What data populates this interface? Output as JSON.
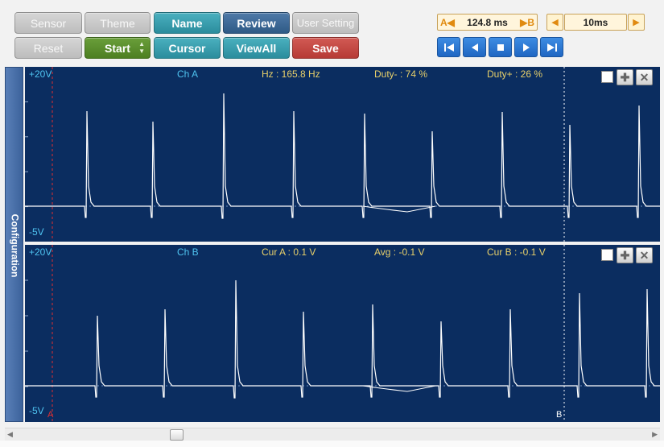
{
  "toolbar": {
    "sensor": "Sensor",
    "theme": "Theme",
    "name": "Name",
    "review": "Review",
    "user_setting": "User Setting",
    "reset": "Reset",
    "start": "Start",
    "cursor": "Cursor",
    "view_all": "ViewAll",
    "save": "Save"
  },
  "cursor_readout": {
    "left_marker": "A",
    "value": "124.8 ms",
    "right_marker": "B"
  },
  "timebase": {
    "value": "10ms"
  },
  "playback_icons": [
    "skip-start-icon",
    "step-back-icon",
    "stop-icon",
    "step-forward-icon",
    "skip-end-icon"
  ],
  "sidebar": {
    "label": "Configuration"
  },
  "panel_a": {
    "top_label": "+20V",
    "bottom_label": "-5V",
    "channel": "Ch A",
    "freq": "Hz : 165.8 Hz",
    "duty_neg": "Duty- : 74 %",
    "duty_pos": "Duty+ : 26 %"
  },
  "panel_b": {
    "top_label": "+20V",
    "bottom_label": "-5V",
    "channel": "Ch B",
    "cur_a": "Cur A : 0.1 V",
    "avg": "Avg : -0.1 V",
    "cur_b": "Cur B : -0.1 V",
    "cursor_a_mark": "A",
    "cursor_b_mark": "B"
  },
  "colors": {
    "plot_bg": "#0b2d60",
    "trace": "#ffffff",
    "label_cyan": "#4fc3f0",
    "label_yellow": "#e8d06a",
    "cursor_a": "#e03030"
  }
}
